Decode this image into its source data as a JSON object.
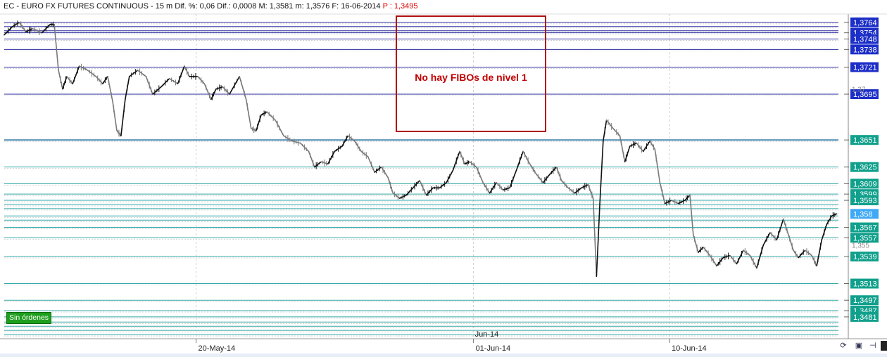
{
  "header": {
    "title": "EC - EURO FX FUTURES CONTINUOUS - 15 m  Dif. %: 0,06  Dif.: 0,0008  M: 1,3581  m: 1,3576  F: 16-06-2014 ",
    "price_text": "P : 1,3495"
  },
  "annotation": {
    "text": "No hay FIBOs de nivel 1"
  },
  "orders_badge": {
    "text": "Sin órdenes"
  },
  "toolbar": {
    "icons": [
      "refresh-icon",
      "save-icon",
      "pin-icon"
    ]
  },
  "colors": {
    "dark_line": "#2a2aa0",
    "teal_line": "#33a8a8",
    "blue_label_bg": "#1c2ec8",
    "teal_label_bg": "#11a08c",
    "current_label_bg": "#3fa9f5",
    "price_up": "#111111",
    "price_down": "#7a7a7a"
  },
  "chart_data": {
    "type": "line",
    "title": "EC - EURO FX FUTURES CONTINUOUS - 15 m",
    "ylim": [
      1.346,
      1.3772
    ],
    "current_price": 1.358,
    "x_ticks": [
      {
        "label": "20-May-14",
        "pos": 0.23
      },
      {
        "label": "01-Jun-14",
        "pos": 0.5625
      },
      {
        "label": "10-Jun-14",
        "pos": 0.7975
      }
    ],
    "month_marker": {
      "label": "Jun-14",
      "pos": 0.5625
    },
    "levels": [
      {
        "value": 1.3764,
        "label": "1,3764",
        "style": "dark"
      },
      {
        "value": 1.376,
        "label": "",
        "style": "dark"
      },
      {
        "value": 1.3756,
        "label": "",
        "style": "dark"
      },
      {
        "value": 1.3754,
        "label": "1,3754",
        "style": "dark"
      },
      {
        "value": 1.3748,
        "label": "1,3748",
        "style": "dark"
      },
      {
        "value": 1.3738,
        "label": "1,3738",
        "style": "dark"
      },
      {
        "value": 1.3721,
        "label": "1,3721",
        "style": "dark"
      },
      {
        "value": 1.3695,
        "label": "1,3695",
        "style": "dark"
      },
      {
        "value": 1.3651,
        "label": "1,3651",
        "style": "darkteal"
      },
      {
        "value": 1.3625,
        "label": "1,3625",
        "style": "teal"
      },
      {
        "value": 1.3609,
        "label": "1,3609",
        "style": "teal"
      },
      {
        "value": 1.3599,
        "label": "1,3599",
        "style": "teal"
      },
      {
        "value": 1.3593,
        "label": "1,3593",
        "style": "teal"
      },
      {
        "value": 1.3589,
        "label": "",
        "style": "teal"
      },
      {
        "value": 1.3585,
        "label": "",
        "style": "teal"
      },
      {
        "value": 1.3578,
        "label": "",
        "style": "teal"
      },
      {
        "value": 1.3574,
        "label": "",
        "style": "teal"
      },
      {
        "value": 1.3567,
        "label": "1,3567",
        "style": "teal"
      },
      {
        "value": 1.3557,
        "label": "1,3557",
        "style": "teal"
      },
      {
        "value": 1.3539,
        "label": "1,3539",
        "style": "teal"
      },
      {
        "value": 1.3513,
        "label": "1,3513",
        "style": "teal"
      },
      {
        "value": 1.3497,
        "label": "1,3497",
        "style": "teal"
      },
      {
        "value": 1.3487,
        "label": "1,3487",
        "style": "teal"
      },
      {
        "value": 1.3481,
        "label": "1,3481",
        "style": "teal"
      },
      {
        "value": 1.3476,
        "label": "",
        "style": "teal"
      },
      {
        "value": 1.3472,
        "label": "",
        "style": "teal"
      },
      {
        "value": 1.3468,
        "label": "",
        "style": "teal"
      },
      {
        "value": 1.3464,
        "label": "",
        "style": "teal"
      }
    ],
    "scale_ticks": [
      {
        "value": 1.37,
        "label": "1,37"
      },
      {
        "value": 1.355,
        "label": "1,355"
      }
    ],
    "price_path": [
      [
        0.0,
        1.3752
      ],
      [
        0.01,
        1.376
      ],
      [
        0.018,
        1.3764
      ],
      [
        0.026,
        1.3755
      ],
      [
        0.034,
        1.3758
      ],
      [
        0.045,
        1.3754
      ],
      [
        0.055,
        1.3762
      ],
      [
        0.06,
        1.3762
      ],
      [
        0.065,
        1.3718
      ],
      [
        0.07,
        1.37
      ],
      [
        0.075,
        1.3712
      ],
      [
        0.082,
        1.3705
      ],
      [
        0.09,
        1.3722
      ],
      [
        0.1,
        1.3718
      ],
      [
        0.11,
        1.3712
      ],
      [
        0.118,
        1.3705
      ],
      [
        0.124,
        1.3712
      ],
      [
        0.13,
        1.3688
      ],
      [
        0.135,
        1.366
      ],
      [
        0.14,
        1.3655
      ],
      [
        0.145,
        1.369
      ],
      [
        0.15,
        1.3712
      ],
      [
        0.16,
        1.3718
      ],
      [
        0.17,
        1.3712
      ],
      [
        0.178,
        1.3695
      ],
      [
        0.188,
        1.3702
      ],
      [
        0.198,
        1.371
      ],
      [
        0.208,
        1.3705
      ],
      [
        0.216,
        1.3722
      ],
      [
        0.222,
        1.3712
      ],
      [
        0.232,
        1.3712
      ],
      [
        0.24,
        1.3705
      ],
      [
        0.248,
        1.369
      ],
      [
        0.254,
        1.37
      ],
      [
        0.262,
        1.3702
      ],
      [
        0.27,
        1.3695
      ],
      [
        0.282,
        1.3712
      ],
      [
        0.29,
        1.369
      ],
      [
        0.296,
        1.3662
      ],
      [
        0.302,
        1.366
      ],
      [
        0.308,
        1.3675
      ],
      [
        0.315,
        1.3678
      ],
      [
        0.325,
        1.367
      ],
      [
        0.335,
        1.3655
      ],
      [
        0.345,
        1.365
      ],
      [
        0.355,
        1.3648
      ],
      [
        0.365,
        1.364
      ],
      [
        0.372,
        1.3625
      ],
      [
        0.38,
        1.363
      ],
      [
        0.388,
        1.3628
      ],
      [
        0.396,
        1.364
      ],
      [
        0.405,
        1.3645
      ],
      [
        0.412,
        1.3655
      ],
      [
        0.42,
        1.365
      ],
      [
        0.428,
        1.364
      ],
      [
        0.436,
        1.3635
      ],
      [
        0.444,
        1.362
      ],
      [
        0.452,
        1.3625
      ],
      [
        0.46,
        1.3615
      ],
      [
        0.466,
        1.36
      ],
      [
        0.474,
        1.3595
      ],
      [
        0.482,
        1.3598
      ],
      [
        0.49,
        1.3605
      ],
      [
        0.498,
        1.3612
      ],
      [
        0.506,
        1.3598
      ],
      [
        0.514,
        1.3605
      ],
      [
        0.522,
        1.3605
      ],
      [
        0.53,
        1.361
      ],
      [
        0.538,
        1.3622
      ],
      [
        0.546,
        1.364
      ],
      [
        0.552,
        1.3628
      ],
      [
        0.558,
        1.363
      ],
      [
        0.566,
        1.3625
      ],
      [
        0.574,
        1.361
      ],
      [
        0.582,
        1.36
      ],
      [
        0.59,
        1.361
      ],
      [
        0.598,
        1.3603
      ],
      [
        0.606,
        1.3605
      ],
      [
        0.614,
        1.3622
      ],
      [
        0.622,
        1.364
      ],
      [
        0.63,
        1.3628
      ],
      [
        0.638,
        1.3618
      ],
      [
        0.646,
        1.361
      ],
      [
        0.654,
        1.3618
      ],
      [
        0.662,
        1.3625
      ],
      [
        0.668,
        1.3612
      ],
      [
        0.676,
        1.3605
      ],
      [
        0.684,
        1.36
      ],
      [
        0.692,
        1.3605
      ],
      [
        0.7,
        1.3608
      ],
      [
        0.706,
        1.3595
      ],
      [
        0.71,
        1.352
      ],
      [
        0.714,
        1.359
      ],
      [
        0.718,
        1.365
      ],
      [
        0.722,
        1.367
      ],
      [
        0.73,
        1.3662
      ],
      [
        0.738,
        1.3655
      ],
      [
        0.744,
        1.363
      ],
      [
        0.75,
        1.3645
      ],
      [
        0.758,
        1.3648
      ],
      [
        0.766,
        1.364
      ],
      [
        0.774,
        1.365
      ],
      [
        0.78,
        1.3642
      ],
      [
        0.786,
        1.361
      ],
      [
        0.792,
        1.359
      ],
      [
        0.8,
        1.3593
      ],
      [
        0.808,
        1.359
      ],
      [
        0.816,
        1.3593
      ],
      [
        0.822,
        1.3598
      ],
      [
        0.826,
        1.356
      ],
      [
        0.832,
        1.3543
      ],
      [
        0.838,
        1.3548
      ],
      [
        0.846,
        1.354
      ],
      [
        0.854,
        1.353
      ],
      [
        0.862,
        1.3538
      ],
      [
        0.87,
        1.354
      ],
      [
        0.878,
        1.3532
      ],
      [
        0.886,
        1.3545
      ],
      [
        0.894,
        1.354
      ],
      [
        0.902,
        1.3528
      ],
      [
        0.91,
        1.355
      ],
      [
        0.918,
        1.3562
      ],
      [
        0.926,
        1.3555
      ],
      [
        0.934,
        1.3575
      ],
      [
        0.94,
        1.356
      ],
      [
        0.946,
        1.3545
      ],
      [
        0.952,
        1.3538
      ],
      [
        0.96,
        1.3545
      ],
      [
        0.968,
        1.354
      ],
      [
        0.974,
        1.353
      ],
      [
        0.98,
        1.3555
      ],
      [
        0.986,
        1.357
      ],
      [
        0.992,
        1.3578
      ],
      [
        0.998,
        1.358
      ]
    ]
  }
}
